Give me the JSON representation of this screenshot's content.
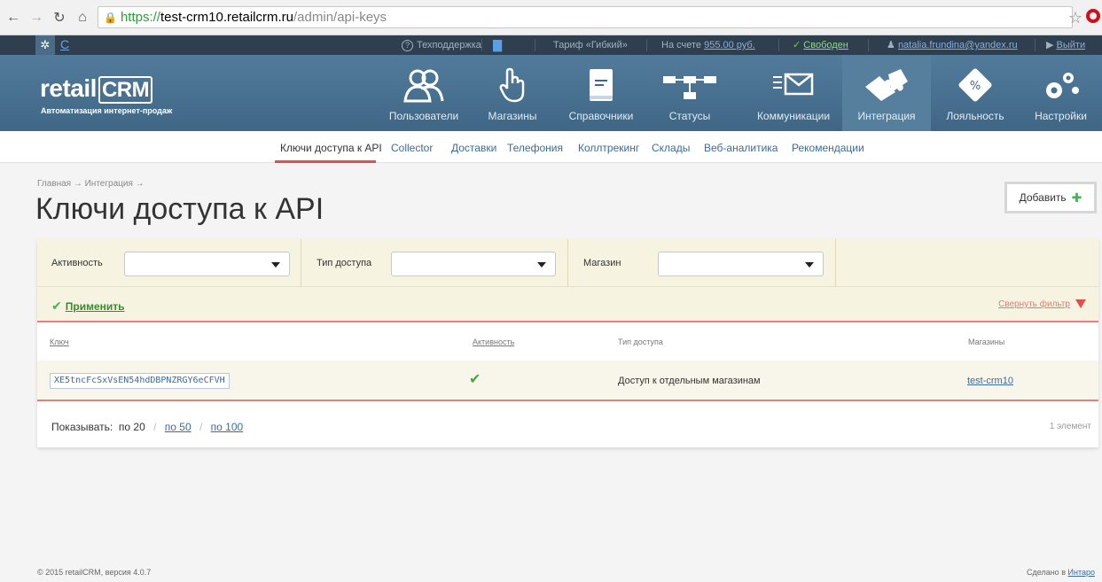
{
  "browser": {
    "url_scheme": "https://",
    "url_host": "test-crm10.retailcrm.ru",
    "url_path": "/admin/api-keys"
  },
  "topbar": {
    "gear": "✲",
    "c_link": "С",
    "support": "Техподдержка",
    "tariff": "Тариф «Гибкий»",
    "balance_label": "На счете",
    "balance_value": "955.00 руб.",
    "status": "Свободен",
    "user": "natalia.frundina@yandex.ru",
    "logout": "Выйти"
  },
  "header": {
    "logo_retail": "retail",
    "logo_crm": "CRM",
    "tagline": "Автоматизация интернет-продаж",
    "menu": [
      {
        "label": "Пользователи",
        "icon": "users-icon"
      },
      {
        "label": "Магазины",
        "icon": "hand-pointer-icon"
      },
      {
        "label": "Справочники",
        "icon": "book-icon"
      },
      {
        "label": "Статусы",
        "icon": "flow-icon"
      },
      {
        "label": "Коммуникации",
        "icon": "envelope-icon"
      },
      {
        "label": "Интеграция",
        "icon": "puzzle-icon"
      },
      {
        "label": "Лояльность",
        "icon": "percent-icon"
      },
      {
        "label": "Настройки",
        "icon": "gears-icon"
      }
    ]
  },
  "submenu": {
    "items": [
      "Ключи доступа к API",
      "Collector",
      "Доставки",
      "Телефония",
      "Коллтрекинг",
      "Склады",
      "Веб-аналитика",
      "Рекомендации"
    ]
  },
  "page": {
    "breadcrumb": "Главная → Интеграция →",
    "title": "Ключи доступа к API",
    "add_button": "Добавить"
  },
  "filters": {
    "activity_label": "Активность",
    "access_type_label": "Тип доступа",
    "shop_label": "Магазин",
    "apply": "Применить",
    "collapse": "Свернуть фильтр"
  },
  "table": {
    "headers": {
      "key": "Ключ",
      "activity": "Активность",
      "access_type": "Тип доступа",
      "shops": "Магазины"
    },
    "rows": [
      {
        "key": "XE5tncFcSxVsEN54hdDBPNZRGY6eCFVH",
        "access_type": "Доступ к отдельным магазинам",
        "shop": "test-crm10"
      }
    ]
  },
  "pager": {
    "label": "Показывать:",
    "current": "по 20",
    "opt50": "по 50",
    "opt100": "по 100",
    "count": "1 элемент"
  },
  "footer": {
    "left": "© 2015 retailCRM, версия 4.0.7",
    "right_prefix": "Сделано в",
    "right_link": "Интаро"
  },
  "colors": {
    "header_bg": "#46708f",
    "topbar_bg": "#2f3f4d",
    "accent_red": "#e34d4d",
    "link_blue": "#3b6b9c",
    "filter_bg": "#f7f3e1",
    "success_green": "#3cb74a"
  }
}
